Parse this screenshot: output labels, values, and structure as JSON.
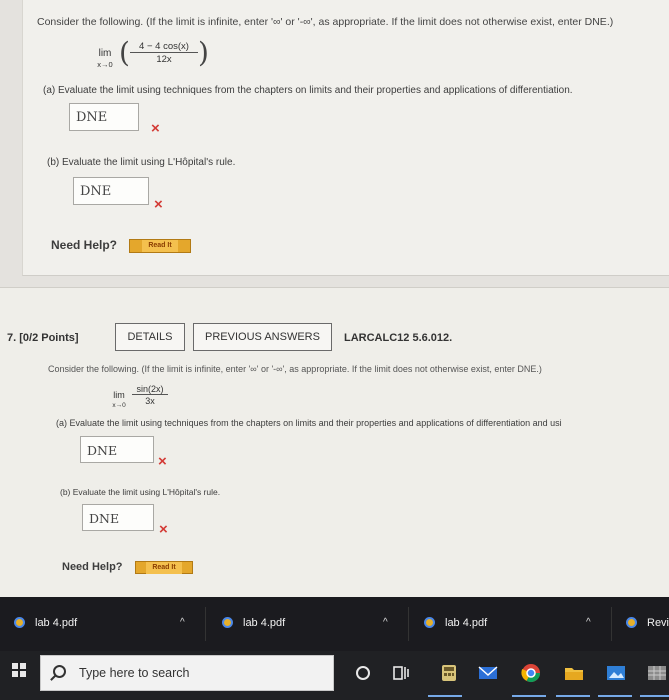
{
  "q6": {
    "prompt": "Consider the following. (If the limit is infinite, enter '∞' or '-∞', as appropriate. If the limit does not otherwise exist, enter DNE.)",
    "lim_word": "lim",
    "lim_sub": "x→0",
    "numerator": "4 − 4 cos(x)",
    "denominator": "12x",
    "part_a_label": "(a)  Evaluate the limit using techniques from the chapters on limits and their properties and applications of differentiation.",
    "part_a_answer": "DNE",
    "part_b_label": "(b)  Evaluate the limit using L'Hôpital's rule.",
    "part_b_answer": "DNE",
    "need_help": "Need Help?",
    "read_it": "Read It"
  },
  "q7": {
    "points": "7.  [0/2 Points]",
    "details_label": "DETAILS",
    "previous_answers_label": "PREVIOUS ANSWERS",
    "code": "LARCALC12 5.6.012.",
    "prompt": "Consider the following. (If the limit is infinite, enter '∞' or '-∞', as appropriate. If the limit does not otherwise exist, enter DNE.)",
    "lim_word": "lim",
    "lim_sub": "x→0",
    "numerator": "sin(2x)",
    "denominator": "3x",
    "part_a_label": "(a)  Evaluate the limit using techniques from the chapters on limits and their properties and applications of differentiation and usi",
    "part_a_answer": "DNE",
    "part_b_label": "(b)  Evaluate the limit using L'Hôpital's rule.",
    "part_b_answer": "DNE",
    "need_help": "Need Help?",
    "read_it": "Read It"
  },
  "incorrect_mark": "×",
  "downloads": [
    {
      "name": "lab 4.pdf",
      "icon": "chrome-icon"
    },
    {
      "name": "lab 4.pdf",
      "icon": "chrome-icon"
    },
    {
      "name": "lab 4.pdf",
      "icon": "chrome-icon"
    },
    {
      "name": "Revi",
      "icon": "chrome-icon"
    }
  ],
  "caret_glyph": "^",
  "taskbar": {
    "search_placeholder": "Type here to search"
  },
  "colors": {
    "incorrect": "#d33a35",
    "read_button": "#e4a72c",
    "taskbar": "#202124"
  }
}
